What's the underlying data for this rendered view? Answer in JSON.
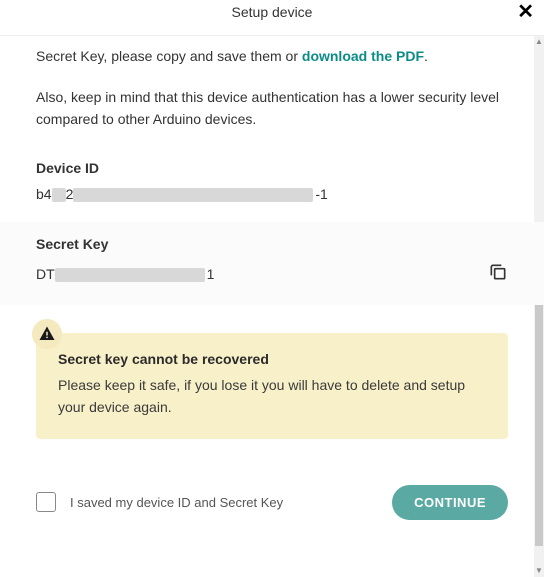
{
  "header": {
    "title": "Setup device",
    "close_label": "✕"
  },
  "intro": {
    "prefix": "Secret Key, please copy and save them or ",
    "link": "download the PDF",
    "suffix": "."
  },
  "note": "Also, keep in mind that this device authentication has a lower security level compared to other Arduino devices.",
  "device_id": {
    "label": "Device ID",
    "prefix": "b4",
    "mid": "2",
    "suffix": "-1"
  },
  "secret_key": {
    "label": "Secret Key",
    "prefix": "DT",
    "suffix": "1",
    "copy_name": "copy-icon"
  },
  "alert": {
    "title": "Secret key cannot be recovered",
    "text": "Please keep it safe, if you lose it you will have to delete and setup your device again."
  },
  "footer": {
    "checkbox_label": "I saved my device ID and Secret Key",
    "continue": "CONTINUE"
  }
}
